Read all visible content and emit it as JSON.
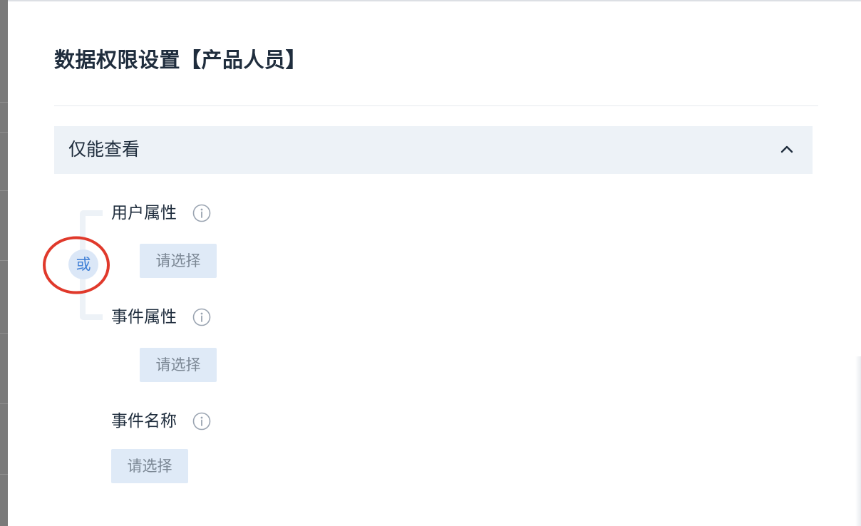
{
  "dialog": {
    "title": "数据权限设置【产品人员】"
  },
  "section": {
    "title": "仅能查看",
    "collapse_icon": "chevron-up-icon"
  },
  "logic": {
    "operator_label": "或"
  },
  "fields": [
    {
      "label": "用户属性",
      "info_icon": "info-icon",
      "select_placeholder": "请选择"
    },
    {
      "label": "事件属性",
      "info_icon": "info-icon",
      "select_placeholder": "请选择"
    },
    {
      "label": "事件名称",
      "info_icon": "info-icon",
      "select_placeholder": "请选择"
    }
  ],
  "colors": {
    "section_bg": "#edf2f7",
    "select_bg": "#dfeaf7",
    "operator_text": "#3f7fd6",
    "highlight_ring": "#e0392b"
  }
}
